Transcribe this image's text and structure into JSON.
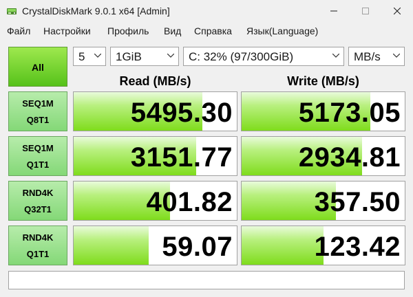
{
  "window": {
    "title": "CrystalDiskMark 9.0.1 x64 [Admin]"
  },
  "menu": [
    "Файл",
    "Настройки",
    "Профиль",
    "Вид",
    "Справка",
    "Язык(Language)"
  ],
  "controls": {
    "all_label": "All",
    "count": "5",
    "size": "1GiB",
    "drive": "C: 32% (97/300GiB)",
    "unit": "MB/s"
  },
  "columns": {
    "read": "Read (MB/s)",
    "write": "Write (MB/s)"
  },
  "rows": [
    {
      "label1": "SEQ1M",
      "label2": "Q8T1",
      "read": "5495.30",
      "write": "5173.05",
      "read_fill": 0.79,
      "write_fill": 0.79
    },
    {
      "label1": "SEQ1M",
      "label2": "Q1T1",
      "read": "3151.77",
      "write": "2934.81",
      "read_fill": 0.75,
      "write_fill": 0.74
    },
    {
      "label1": "RND4K",
      "label2": "Q32T1",
      "read": "401.82",
      "write": "357.50",
      "read_fill": 0.59,
      "write_fill": 0.58
    },
    {
      "label1": "RND4K",
      "label2": "Q1T1",
      "read": "59.07",
      "write": "123.42",
      "read_fill": 0.46,
      "write_fill": 0.5
    }
  ],
  "comment": "",
  "colors": {
    "bar_green": "#7fdc1c",
    "all_button_green": "#56c21a",
    "label_green": "#84d877"
  }
}
